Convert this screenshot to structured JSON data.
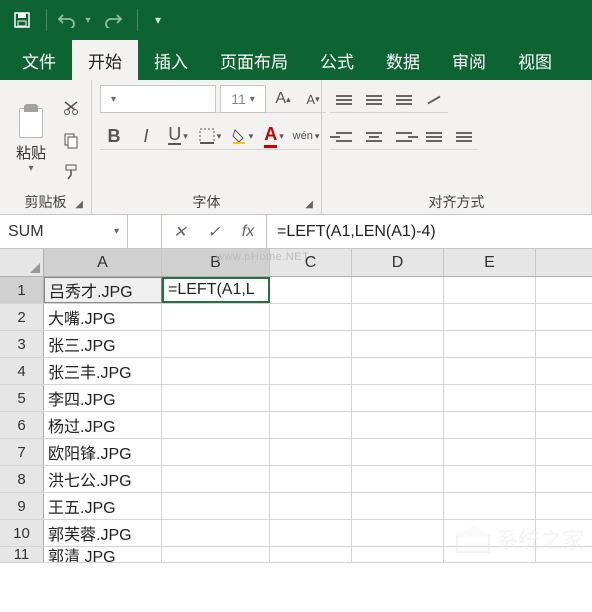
{
  "titlebar": {
    "save_icon": "save-icon",
    "undo_icon": "undo-icon",
    "redo_icon": "redo-icon",
    "customize_icon": "customize-qat-icon"
  },
  "tabs": {
    "file": "文件",
    "home": "开始",
    "insert": "插入",
    "pagelayout": "页面布局",
    "formulas": "公式",
    "data": "数据",
    "review": "审阅",
    "view": "视图"
  },
  "ribbon": {
    "clipboard": {
      "paste": "粘贴",
      "label": "剪贴板"
    },
    "font": {
      "name_placeholder": "",
      "size_value": "11",
      "bold": "B",
      "italic": "I",
      "underline": "U",
      "phonetic": "wén",
      "label": "字体",
      "grow": "A",
      "shrink": "A"
    },
    "align": {
      "label": "对齐方式"
    }
  },
  "namebox": {
    "name": "SUM",
    "cancel": "✕",
    "confirm": "✓",
    "fx": "fx",
    "formula": "=LEFT(A1,LEN(A1)-4)"
  },
  "columns": [
    "A",
    "B",
    "C",
    "D",
    "E"
  ],
  "rows": [
    {
      "n": "1",
      "a": "吕秀才.JPG",
      "b": "=LEFT(A1,L"
    },
    {
      "n": "2",
      "a": "大嘴.JPG",
      "b": ""
    },
    {
      "n": "3",
      "a": "张三.JPG",
      "b": ""
    },
    {
      "n": "4",
      "a": "张三丰.JPG",
      "b": ""
    },
    {
      "n": "5",
      "a": "李四.JPG",
      "b": ""
    },
    {
      "n": "6",
      "a": "杨过.JPG",
      "b": ""
    },
    {
      "n": "7",
      "a": "欧阳锋.JPG",
      "b": ""
    },
    {
      "n": "8",
      "a": "洪七公.JPG",
      "b": ""
    },
    {
      "n": "9",
      "a": "王五.JPG",
      "b": ""
    },
    {
      "n": "10",
      "a": "郭芙蓉.JPG",
      "b": ""
    },
    {
      "n": "11",
      "a": "郭清 JPG",
      "b": ""
    }
  ],
  "watermark": "www.pHome.NET",
  "bottom_watermark": "系统之家"
}
